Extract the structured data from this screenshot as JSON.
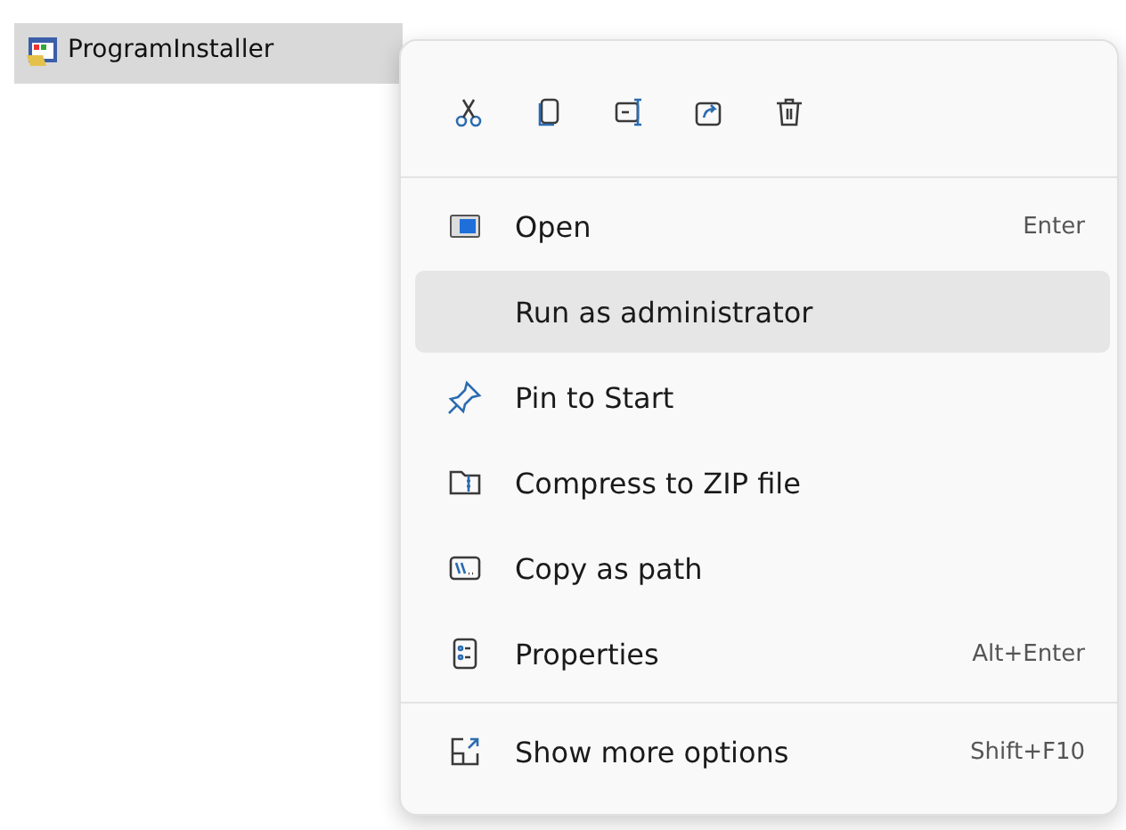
{
  "file": {
    "name": "ProgramInstaller",
    "selected": true
  },
  "menu": {
    "groups": [
      [
        {
          "label": "Open",
          "shortcut": "Enter",
          "selected": false
        },
        {
          "label": "Run as administrator",
          "selected": true
        },
        {
          "label": "Pin to Start",
          "selected": false
        },
        {
          "label": "Compress to ZIP file",
          "selected": false
        },
        {
          "label": "Copy as path",
          "selected": false
        },
        {
          "label": "Properties",
          "shortcut": "Alt+Enter",
          "selected": false
        }
      ],
      [
        {
          "label": "Show more options",
          "shortcut": "Shift+F10",
          "selected": false
        }
      ]
    ]
  }
}
